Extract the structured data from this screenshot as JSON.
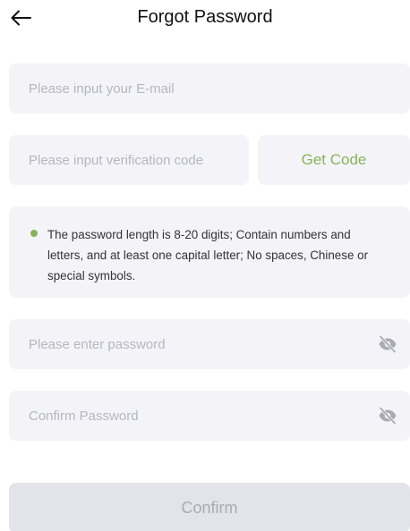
{
  "header": {
    "title": "Forgot Password"
  },
  "form": {
    "email_placeholder": "Please input your E-mail",
    "code_placeholder": "Please input verification code",
    "get_code_label": "Get Code",
    "hint_text": "The password length is 8-20 digits; Contain numbers and letters, and at least one capital letter; No spaces, Chinese or special symbols.",
    "password_placeholder": "Please enter password",
    "confirm_password_placeholder": "Confirm Password",
    "confirm_label": "Confirm"
  },
  "icons": {
    "back": "arrow-left-icon",
    "hint_bullet": "dot-icon",
    "password_visibility": "eye-off-icon",
    "confirm_visibility": "eye-off-icon"
  },
  "colors": {
    "accent": "#86b45a",
    "field_bg": "#f4f4f8",
    "button_disabled_bg": "#e3e4ea",
    "button_disabled_text": "#a9abb4",
    "placeholder": "#b4b7c0"
  }
}
